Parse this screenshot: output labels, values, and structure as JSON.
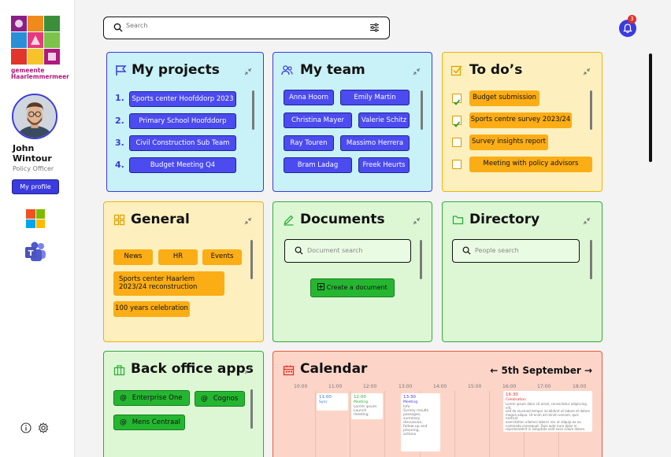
{
  "sidebar": {
    "org_line1": "gemeente",
    "org_line2": "Haarlemmermeer",
    "user_name": "John Wintour",
    "user_role": "Policy Officer",
    "profile_button": "My profile"
  },
  "search": {
    "placeholder": "Search"
  },
  "notifications": {
    "count": "3"
  },
  "projects": {
    "title": "My projects",
    "items": [
      {
        "num": "1.",
        "label": "Sports center Hoofddorp 2023"
      },
      {
        "num": "2.",
        "label": "Primary School Hoofddorp"
      },
      {
        "num": "3.",
        "label": "Civil Construction Sub Team"
      },
      {
        "num": "4.",
        "label": "Budget Meeting Q4"
      }
    ]
  },
  "team": {
    "title": "My team",
    "members": [
      "Anna Hoorn",
      "Emily Martin",
      "Christina Mayer",
      "Valerie Schitz",
      "Ray Touren",
      "Massimo Herrera",
      "Bram Ladag",
      "Freek Heurts"
    ]
  },
  "todos": {
    "title": "To do’s",
    "items": [
      {
        "label": "Budget submission",
        "checked": true
      },
      {
        "label": "Sports centre survey 2023/24",
        "checked": true
      },
      {
        "label": "Survey insights report",
        "checked": false
      },
      {
        "label": "Meeting with policy advisors",
        "checked": false
      }
    ]
  },
  "general": {
    "title": "General",
    "tags": [
      "News",
      "HR",
      "Events",
      "Sports center Haarlem 2023/24 reconstruction",
      "100 years celebration"
    ]
  },
  "documents": {
    "title": "Documents",
    "search_placeholder": "Document search",
    "create_button": "Create a document"
  },
  "directory": {
    "title": "Directory",
    "search_placeholder": "People search"
  },
  "backoffice": {
    "title": "Back office apps",
    "apps": [
      "Enterprise One",
      "Cognos",
      "Mens Centraal"
    ]
  },
  "calendar": {
    "title": "Calendar",
    "date_label": "5th September",
    "hours": [
      "10:00",
      "11:00",
      "12:00",
      "13:00",
      "14:00",
      "15:00",
      "16:00",
      "17:00",
      "18:00"
    ],
    "events": [
      {
        "time": "11:00",
        "label": "Sync",
        "color": "#2a7bd9"
      },
      {
        "time": "12:00",
        "label": "Meeting",
        "note": "Lorem ipsum\nLaunch meeting",
        "color": "#2eae3a"
      },
      {
        "time": "13:30",
        "label": "Meeting",
        "note": "Info\nSurvey results passages,\nsummary discussion,\nfollow-up and planning,\nactions",
        "color": "#3b3be0"
      },
      {
        "time": "16:30",
        "label": "Celebration",
        "note": "Lorem ipsum dolor sit amet, consectetur adipiscing elit,\nsed do eiusmod tempor incididunt ut labore et dolore\nmagna aliqua. Ut enim ad minim veniam, quis nostrud\nexercitation ullamco laboris nisi ut aliquip ex ea\ncommodo consequat. Duis aute irure dolor in\nreprehenderit in voluptate velit esse cillum dolore.",
        "color": "#e0312b"
      }
    ]
  },
  "colors": {
    "primary": "#3b3be0",
    "blue_card": "#c8f2f7",
    "yellow_card": "#fdf0be",
    "green_card": "#ddf7d4",
    "red_card": "#fcd5c8",
    "orange_pill": "#fbad16",
    "green_pill": "#25b631"
  },
  "icons": [
    "search-icon",
    "filter-icon",
    "bell-icon",
    "flag-icon",
    "team-icon",
    "checkbox-icon",
    "grid-icon",
    "edit-icon",
    "folder-icon",
    "briefcase-icon",
    "calendar-icon",
    "collapse-icon",
    "info-icon",
    "settings-icon",
    "microsoft-logo",
    "teams-logo",
    "at-icon"
  ]
}
